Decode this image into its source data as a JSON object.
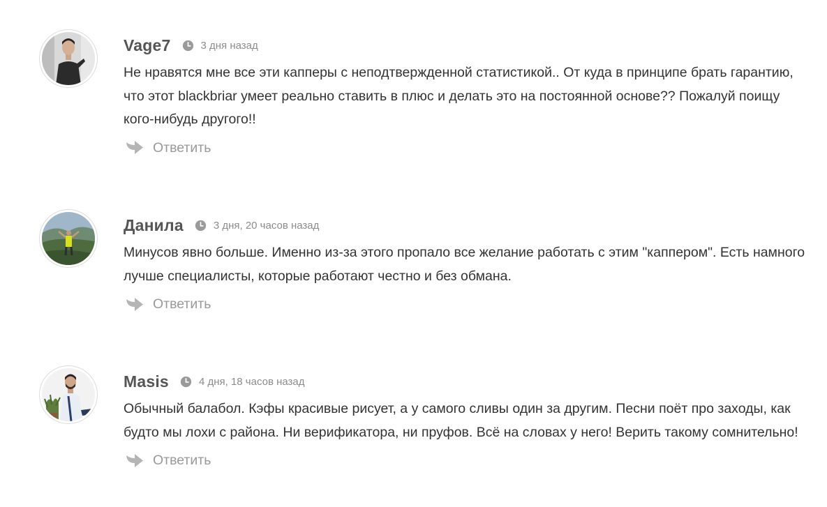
{
  "comments": [
    {
      "author": "Vage7",
      "date": "3 дня назад",
      "text": "Не нравятся мне все эти капперы с неподтвержденной статистикой.. От куда в принципе брать гарантию, что этот blackbriar умеет реально ставить в плюс и делать это на постоянной основе?? Пожалуй поищу кого-нибудь другого!!",
      "reply": "Ответить"
    },
    {
      "author": "Данила",
      "date": "3 дня, 20 часов назад",
      "text": "Минусов явно больше. Именно из-за этого пропало все желание работать с этим \"каппером\". Есть намного лучше специалисты, которые работают честно и без обмана.",
      "reply": "Ответить"
    },
    {
      "author": "Masis",
      "date": "4 дня, 18 часов назад",
      "text": "Обычный балабол. Кэфы красивые рисует, а у самого сливы один за другим. Песни поёт про заходы, как будто мы лохи с района. Ни верификатора, ни пруфов. Всё на словах у него! Верить такому сомнительно!",
      "reply": "Ответить"
    }
  ],
  "icons": {
    "time": "clock-icon",
    "reply": "reply-arrow-icon"
  },
  "colors": {
    "author": "#555555",
    "text": "#333333",
    "meta": "#8c8c8c",
    "reply": "#999999"
  }
}
